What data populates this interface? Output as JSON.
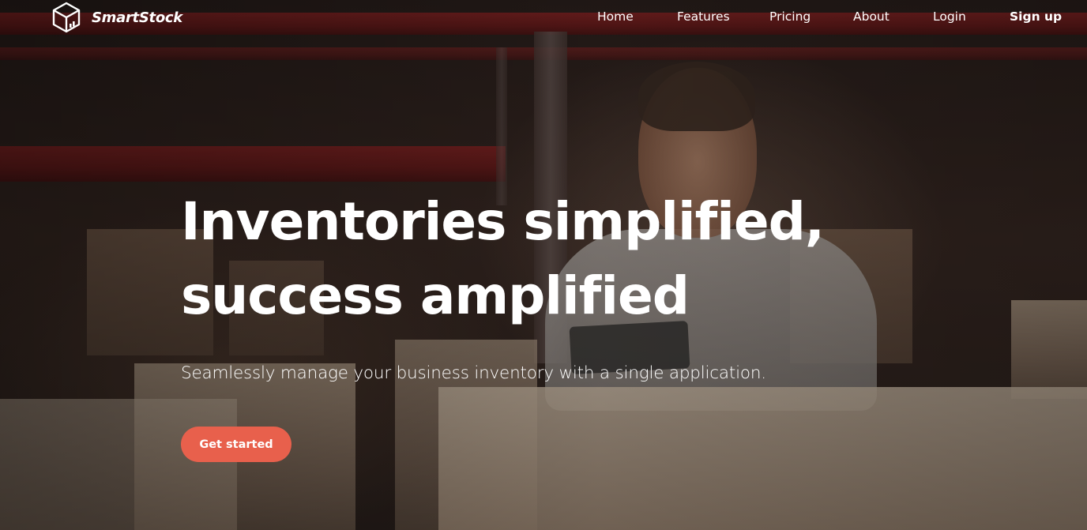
{
  "navbar": {
    "brand_name": "SmartStock",
    "logo_icon": "cube-chart-icon",
    "links": {
      "home": "Home",
      "features": "Features",
      "pricing": "Pricing",
      "about": "About",
      "login": "Login",
      "signup": "Sign up"
    }
  },
  "hero": {
    "headline_line1": "Inventories simplified,",
    "headline_line2": "success amplified",
    "subtitle": "Seamlessly manage your business inventory with a single application.",
    "cta_label": "Get started"
  },
  "colors": {
    "accent": "#e8604c",
    "text": "#ffffff"
  }
}
